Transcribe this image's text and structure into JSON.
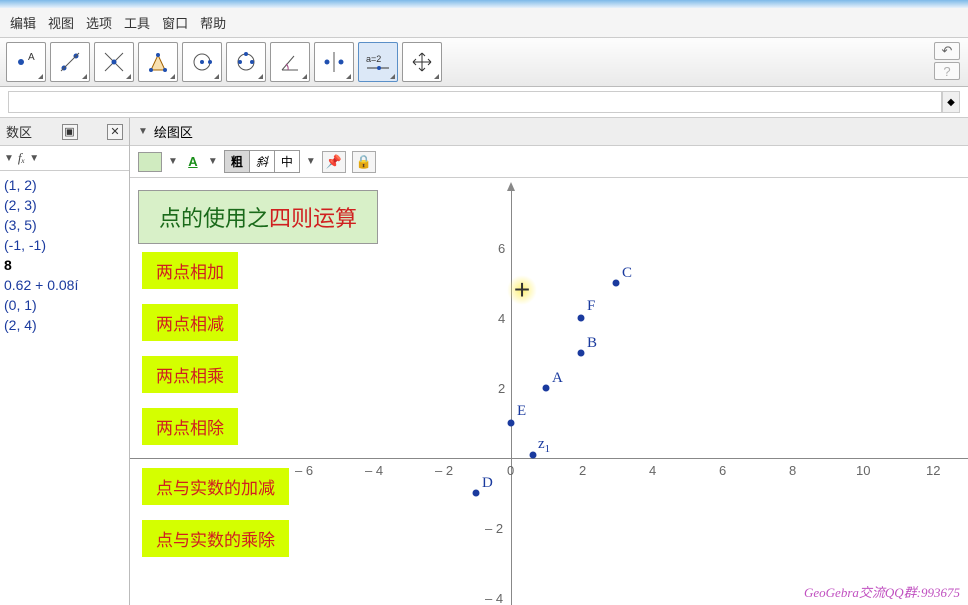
{
  "menu": {
    "items": [
      "编辑",
      "视图",
      "选项",
      "工具",
      "窗口",
      "帮助"
    ]
  },
  "panels": {
    "algebra_title": "数区",
    "graphics_title": "绘图区"
  },
  "fx_label": "fₓ",
  "algebra": {
    "items": [
      "(1, 2)",
      "(2, 3)",
      "(3, 5)",
      "(-1, -1)",
      "8",
      "0.62 + 0.08í",
      "(0, 1)",
      "(2, 4)"
    ]
  },
  "stylebar": {
    "segs": [
      "粗",
      "斜",
      "中"
    ]
  },
  "title_box": {
    "part1": "点的使用之",
    "part2": "四则运算"
  },
  "ops": {
    "btn1": "两点相加",
    "btn2": "两点相减",
    "btn3": "两点相乘",
    "btn4": "两点相除",
    "btn5": "点与实数的加减",
    "btn6": "点与实数的乘除"
  },
  "footer": "GeoGebra交流QQ群:993675",
  "chart_data": {
    "type": "scatter",
    "title": "",
    "xlabel": "",
    "ylabel": "",
    "xlim": [
      -6,
      12
    ],
    "ylim": [
      -4,
      6
    ],
    "points": [
      {
        "label": "A",
        "x": 1,
        "y": 2
      },
      {
        "label": "B",
        "x": 2,
        "y": 3
      },
      {
        "label": "C",
        "x": 3,
        "y": 5
      },
      {
        "label": "D",
        "x": -1,
        "y": -1
      },
      {
        "label": "E",
        "x": 0,
        "y": 1
      },
      {
        "label": "F",
        "x": 2,
        "y": 4
      },
      {
        "label": "z₁",
        "x": 0.62,
        "y": 0.08
      }
    ],
    "x_ticks": [
      -6,
      -4,
      -2,
      0,
      2,
      4,
      6,
      8,
      10,
      12
    ],
    "y_ticks": [
      -4,
      -2,
      2,
      4,
      6
    ]
  },
  "axis_labels": {
    "x": {
      "n6": "– 6",
      "n4": "– 4",
      "n2": "– 2",
      "0": "0",
      "2": "2",
      "4": "4",
      "6": "6",
      "8": "8",
      "10": "10",
      "12": "12"
    },
    "y": {
      "n4": "– 4",
      "n2": "– 2",
      "2": "2",
      "4": "4",
      "6": "6"
    }
  },
  "point_labels": {
    "A": "A",
    "B": "B",
    "C": "C",
    "D": "D",
    "E": "E",
    "F": "F",
    "z1": "z"
  }
}
